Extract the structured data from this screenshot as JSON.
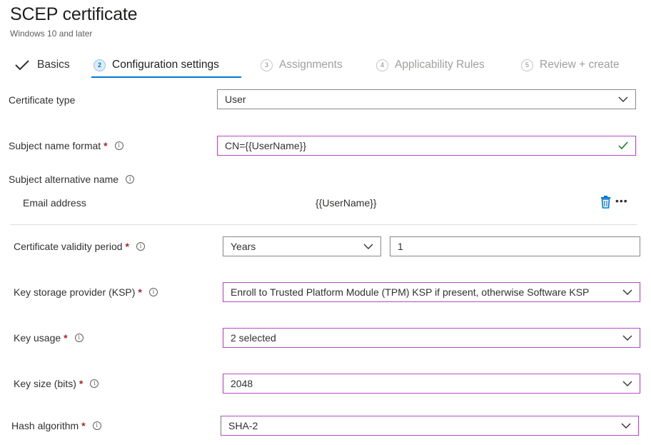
{
  "header": {
    "title": "SCEP certificate",
    "subtitle": "Windows 10 and later"
  },
  "wizard": {
    "tabs": [
      {
        "step": "",
        "label": "Basics",
        "state": "done"
      },
      {
        "step": "2",
        "label": "Configuration settings",
        "state": "active"
      },
      {
        "step": "3",
        "label": "Assignments",
        "state": "pending"
      },
      {
        "step": "4",
        "label": "Applicability Rules",
        "state": "pending"
      },
      {
        "step": "5",
        "label": "Review + create",
        "state": "pending"
      }
    ]
  },
  "form": {
    "certificate_type": {
      "label": "Certificate type",
      "value": "User"
    },
    "subject_name_format": {
      "label": "Subject name format",
      "required": "*",
      "value": "CN={{UserName}}"
    },
    "subject_alternative_name": {
      "label": "Subject alternative name",
      "rows": [
        {
          "attribute": "Email address",
          "value": "{{UserName}}"
        }
      ]
    },
    "validity_period": {
      "label": "Certificate validity period",
      "required": "*",
      "unit": "Years",
      "amount": "1"
    },
    "ksp": {
      "label": "Key storage provider (KSP)",
      "required": "*",
      "value": "Enroll to Trusted Platform Module (TPM) KSP if present, otherwise Software KSP"
    },
    "key_usage": {
      "label": "Key usage",
      "required": "*",
      "value": "2 selected"
    },
    "key_size": {
      "label": "Key size (bits)",
      "required": "*",
      "value": "2048"
    },
    "hash_algorithm": {
      "label": "Hash algorithm",
      "required": "*",
      "value": "SHA-2"
    }
  },
  "icons": {
    "info": "i",
    "more": "•••"
  },
  "colors": {
    "accent": "#0078d4",
    "focus_border": "#b34fc5",
    "required": "#a4262c",
    "valid": "#107c10"
  }
}
